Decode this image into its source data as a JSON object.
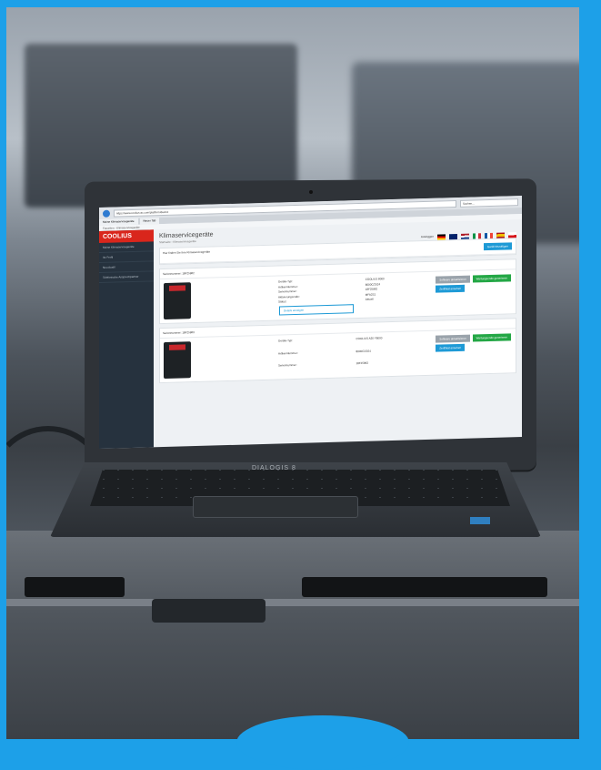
{
  "browser": {
    "url": "https://www.coolius-ac.com/platform/device",
    "tab1": "Meine Klimaservicegeräte",
    "tab2": "Neuer Tab",
    "search_placeholder": "Suchen...",
    "bookmarks": "Favoriten - Klimaservicegeräte"
  },
  "app": {
    "logo": "COOLIUS",
    "side_items": [
      "Meine Klimaservicegeräte",
      "Ihr Profil",
      "Neu Ausfil",
      "Telefonische Ansprechpartner"
    ],
    "page_title": "Klimaservicegeräte",
    "breadcrumb": "Startseite › Klimaservicegeräte",
    "logout": "Ausloggen",
    "search_text": "Hier finden Sie Ihre Klimaservicegeräte",
    "add_button": "Gerät hinzufügen",
    "colors": {
      "accent": "#1e9ad6",
      "logo": "#d9261c",
      "sidebar": "#26323e",
      "green": "#23a745"
    }
  },
  "devices": [
    {
      "header": "Seriennummer: 18F25862",
      "labels": [
        "Geräte-Typ:",
        "Artikel-Nummer:",
        "Seriennummer:",
        "Aktivierungscode:",
        "Status:"
      ],
      "values": [
        "COOLIUS 8000",
        "8000C/2024",
        "18F25862",
        "MFA2S1",
        "Aktuell"
      ],
      "detail_button": "Details anzeigen",
      "grey_button": "Software aktualisieren",
      "green_button": "Wartungscode generieren",
      "blue_button": "Zertifikat ansehen"
    },
    {
      "header": "Seriennummer: 18F25863",
      "labels": [
        "Geräte-Typ:",
        "Artikel-Nummer:",
        "Seriennummer:"
      ],
      "values": [
        "COOLIUS A30 Y8000",
        "8000C/2024",
        "18F25863"
      ],
      "grey_button": "Software aktualisieren",
      "green_button": "Wartungscode generieren",
      "blue_button": "Zertifikat ansehen"
    }
  ],
  "laptop": {
    "keyboard_brand": "DIALOGIS 8"
  },
  "flags": [
    "#000",
    "#cf142b",
    "#0055a4",
    "#009246",
    "#0055a4",
    "#aa151b",
    "#d7141a"
  ]
}
